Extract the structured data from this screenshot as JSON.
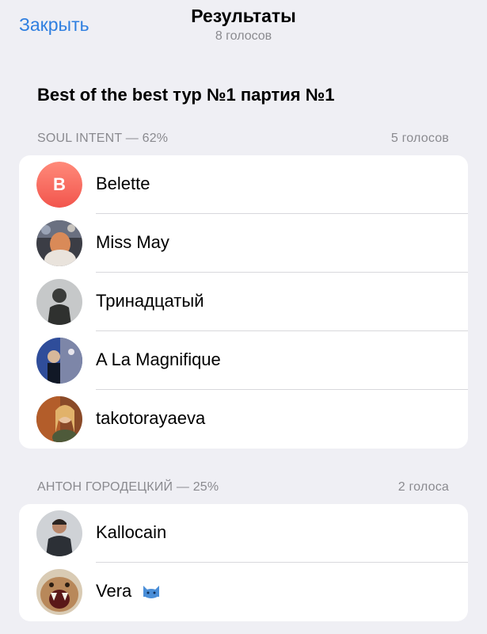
{
  "header": {
    "close_label": "Закрыть",
    "title": "Результаты",
    "subtitle": "8 голосов"
  },
  "poll": {
    "question": "Best of the best тур №1 партия №1"
  },
  "options": [
    {
      "label": "SOUL INTENT — 62%",
      "votes": "5 голосов",
      "voters": [
        {
          "name": "Belette",
          "avatar": "letter",
          "initial": "B"
        },
        {
          "name": "Miss May",
          "avatar": "photo"
        },
        {
          "name": "Тринадцатый",
          "avatar": "photo"
        },
        {
          "name": "A La Magnifique",
          "avatar": "photo"
        },
        {
          "name": "takotorayaeva",
          "avatar": "photo"
        }
      ]
    },
    {
      "label": "АНТОН ГОРОДЕЦКИЙ — 25%",
      "votes": "2 голоса",
      "voters": [
        {
          "name": "Kallocain",
          "avatar": "photo"
        },
        {
          "name": "Vera",
          "avatar": "photo",
          "badge": "blue-cat-emoji-icon"
        }
      ]
    }
  ],
  "colors": {
    "accent": "#2f7fe0",
    "background": "#efeff4",
    "secondary_text": "#8a8a8f",
    "avatar_letter_gradient_top": "#ff8a7a",
    "avatar_letter_gradient_bottom": "#f2554d"
  }
}
